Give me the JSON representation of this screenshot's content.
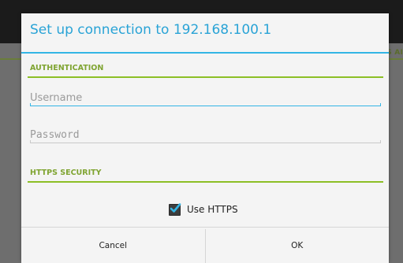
{
  "background": {
    "partial_text": "S AI"
  },
  "dialog": {
    "title": "Set up connection to 192.168.100.1",
    "sections": {
      "authentication": "AUTHENTICATION",
      "https_security": "HTTPS SECURITY"
    },
    "fields": {
      "username": {
        "placeholder": "Username",
        "value": ""
      },
      "password": {
        "placeholder": "Password",
        "value": ""
      }
    },
    "use_https": {
      "label": "Use HTTPS",
      "checked": true
    },
    "buttons": {
      "cancel": "Cancel",
      "ok": "OK"
    }
  },
  "colors": {
    "accent_blue": "#33b5e5",
    "section_green": "#8cbf26",
    "dialog_bg": "#f4f4f4"
  }
}
